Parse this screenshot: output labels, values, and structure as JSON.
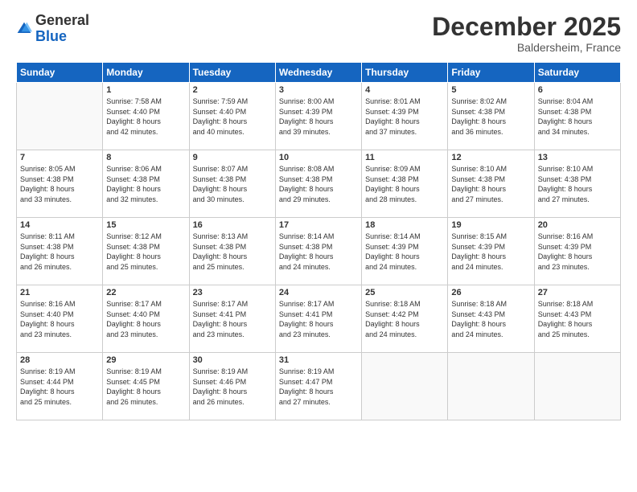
{
  "logo": {
    "general": "General",
    "blue": "Blue"
  },
  "header": {
    "month": "December 2025",
    "location": "Baldersheim, France"
  },
  "days_of_week": [
    "Sunday",
    "Monday",
    "Tuesday",
    "Wednesday",
    "Thursday",
    "Friday",
    "Saturday"
  ],
  "weeks": [
    [
      {
        "day": "",
        "sunrise": "",
        "sunset": "",
        "daylight": ""
      },
      {
        "day": "1",
        "sunrise": "Sunrise: 7:58 AM",
        "sunset": "Sunset: 4:40 PM",
        "daylight": "Daylight: 8 hours and 42 minutes."
      },
      {
        "day": "2",
        "sunrise": "Sunrise: 7:59 AM",
        "sunset": "Sunset: 4:40 PM",
        "daylight": "Daylight: 8 hours and 40 minutes."
      },
      {
        "day": "3",
        "sunrise": "Sunrise: 8:00 AM",
        "sunset": "Sunset: 4:39 PM",
        "daylight": "Daylight: 8 hours and 39 minutes."
      },
      {
        "day": "4",
        "sunrise": "Sunrise: 8:01 AM",
        "sunset": "Sunset: 4:39 PM",
        "daylight": "Daylight: 8 hours and 37 minutes."
      },
      {
        "day": "5",
        "sunrise": "Sunrise: 8:02 AM",
        "sunset": "Sunset: 4:38 PM",
        "daylight": "Daylight: 8 hours and 36 minutes."
      },
      {
        "day": "6",
        "sunrise": "Sunrise: 8:04 AM",
        "sunset": "Sunset: 4:38 PM",
        "daylight": "Daylight: 8 hours and 34 minutes."
      }
    ],
    [
      {
        "day": "7",
        "sunrise": "Sunrise: 8:05 AM",
        "sunset": "Sunset: 4:38 PM",
        "daylight": "Daylight: 8 hours and 33 minutes."
      },
      {
        "day": "8",
        "sunrise": "Sunrise: 8:06 AM",
        "sunset": "Sunset: 4:38 PM",
        "daylight": "Daylight: 8 hours and 32 minutes."
      },
      {
        "day": "9",
        "sunrise": "Sunrise: 8:07 AM",
        "sunset": "Sunset: 4:38 PM",
        "daylight": "Daylight: 8 hours and 30 minutes."
      },
      {
        "day": "10",
        "sunrise": "Sunrise: 8:08 AM",
        "sunset": "Sunset: 4:38 PM",
        "daylight": "Daylight: 8 hours and 29 minutes."
      },
      {
        "day": "11",
        "sunrise": "Sunrise: 8:09 AM",
        "sunset": "Sunset: 4:38 PM",
        "daylight": "Daylight: 8 hours and 28 minutes."
      },
      {
        "day": "12",
        "sunrise": "Sunrise: 8:10 AM",
        "sunset": "Sunset: 4:38 PM",
        "daylight": "Daylight: 8 hours and 27 minutes."
      },
      {
        "day": "13",
        "sunrise": "Sunrise: 8:10 AM",
        "sunset": "Sunset: 4:38 PM",
        "daylight": "Daylight: 8 hours and 27 minutes."
      }
    ],
    [
      {
        "day": "14",
        "sunrise": "Sunrise: 8:11 AM",
        "sunset": "Sunset: 4:38 PM",
        "daylight": "Daylight: 8 hours and 26 minutes."
      },
      {
        "day": "15",
        "sunrise": "Sunrise: 8:12 AM",
        "sunset": "Sunset: 4:38 PM",
        "daylight": "Daylight: 8 hours and 25 minutes."
      },
      {
        "day": "16",
        "sunrise": "Sunrise: 8:13 AM",
        "sunset": "Sunset: 4:38 PM",
        "daylight": "Daylight: 8 hours and 25 minutes."
      },
      {
        "day": "17",
        "sunrise": "Sunrise: 8:14 AM",
        "sunset": "Sunset: 4:38 PM",
        "daylight": "Daylight: 8 hours and 24 minutes."
      },
      {
        "day": "18",
        "sunrise": "Sunrise: 8:14 AM",
        "sunset": "Sunset: 4:39 PM",
        "daylight": "Daylight: 8 hours and 24 minutes."
      },
      {
        "day": "19",
        "sunrise": "Sunrise: 8:15 AM",
        "sunset": "Sunset: 4:39 PM",
        "daylight": "Daylight: 8 hours and 24 minutes."
      },
      {
        "day": "20",
        "sunrise": "Sunrise: 8:16 AM",
        "sunset": "Sunset: 4:39 PM",
        "daylight": "Daylight: 8 hours and 23 minutes."
      }
    ],
    [
      {
        "day": "21",
        "sunrise": "Sunrise: 8:16 AM",
        "sunset": "Sunset: 4:40 PM",
        "daylight": "Daylight: 8 hours and 23 minutes."
      },
      {
        "day": "22",
        "sunrise": "Sunrise: 8:17 AM",
        "sunset": "Sunset: 4:40 PM",
        "daylight": "Daylight: 8 hours and 23 minutes."
      },
      {
        "day": "23",
        "sunrise": "Sunrise: 8:17 AM",
        "sunset": "Sunset: 4:41 PM",
        "daylight": "Daylight: 8 hours and 23 minutes."
      },
      {
        "day": "24",
        "sunrise": "Sunrise: 8:17 AM",
        "sunset": "Sunset: 4:41 PM",
        "daylight": "Daylight: 8 hours and 23 minutes."
      },
      {
        "day": "25",
        "sunrise": "Sunrise: 8:18 AM",
        "sunset": "Sunset: 4:42 PM",
        "daylight": "Daylight: 8 hours and 24 minutes."
      },
      {
        "day": "26",
        "sunrise": "Sunrise: 8:18 AM",
        "sunset": "Sunset: 4:43 PM",
        "daylight": "Daylight: 8 hours and 24 minutes."
      },
      {
        "day": "27",
        "sunrise": "Sunrise: 8:18 AM",
        "sunset": "Sunset: 4:43 PM",
        "daylight": "Daylight: 8 hours and 25 minutes."
      }
    ],
    [
      {
        "day": "28",
        "sunrise": "Sunrise: 8:19 AM",
        "sunset": "Sunset: 4:44 PM",
        "daylight": "Daylight: 8 hours and 25 minutes."
      },
      {
        "day": "29",
        "sunrise": "Sunrise: 8:19 AM",
        "sunset": "Sunset: 4:45 PM",
        "daylight": "Daylight: 8 hours and 26 minutes."
      },
      {
        "day": "30",
        "sunrise": "Sunrise: 8:19 AM",
        "sunset": "Sunset: 4:46 PM",
        "daylight": "Daylight: 8 hours and 26 minutes."
      },
      {
        "day": "31",
        "sunrise": "Sunrise: 8:19 AM",
        "sunset": "Sunset: 4:47 PM",
        "daylight": "Daylight: 8 hours and 27 minutes."
      },
      {
        "day": "",
        "sunrise": "",
        "sunset": "",
        "daylight": ""
      },
      {
        "day": "",
        "sunrise": "",
        "sunset": "",
        "daylight": ""
      },
      {
        "day": "",
        "sunrise": "",
        "sunset": "",
        "daylight": ""
      }
    ]
  ]
}
